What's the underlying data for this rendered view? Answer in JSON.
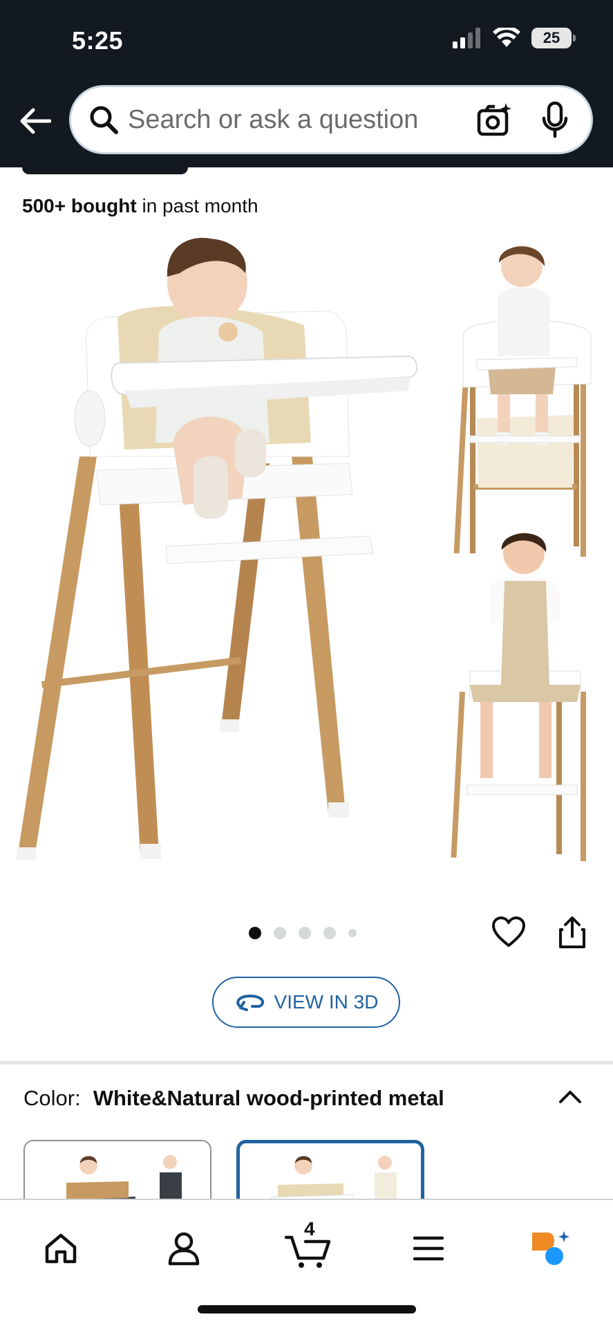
{
  "status_bar": {
    "time": "5:25",
    "battery": "25"
  },
  "search": {
    "placeholder": "Search or ask a question"
  },
  "product": {
    "bought_bold": "500+ bought",
    "bought_rest": " in past month",
    "image_count": 5,
    "active_image": 1,
    "view_3d_label": "VIEW IN 3D",
    "color_label": "Color:",
    "color_value": "White&Natural wood-printed metal"
  },
  "bottom_nav": {
    "items": [
      "home-icon",
      "account-icon",
      "cart-icon",
      "menu-icon",
      "rufus-icon"
    ],
    "cart_count": "4"
  },
  "colors": {
    "header_bg": "#131921",
    "link_blue": "#2162a1",
    "accent_orange": "#f08a24"
  }
}
